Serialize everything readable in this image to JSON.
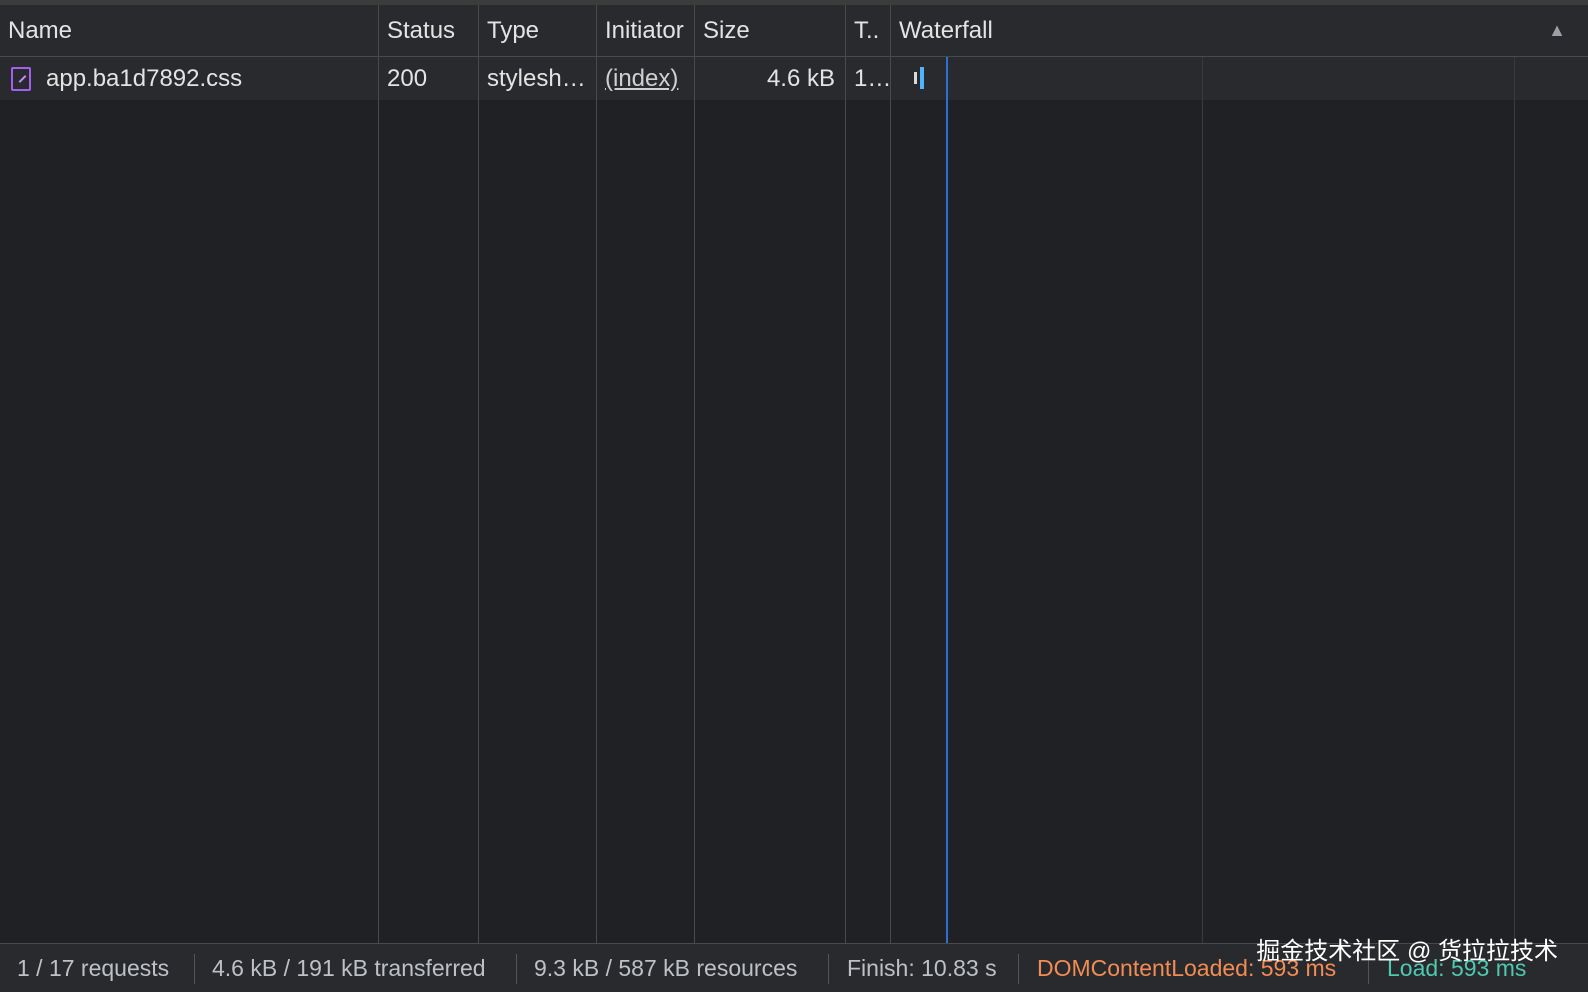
{
  "columns": {
    "name": "Name",
    "status": "Status",
    "type": "Type",
    "initiator": "Initiator",
    "size": "Size",
    "time": "T..",
    "waterfall": "Waterfall",
    "sort_indicator": "▲"
  },
  "rows": [
    {
      "icon": "stylesheet-file-icon",
      "name": "app.ba1d7892.css",
      "status": "200",
      "type": "stylesh…",
      "initiator": "(index)",
      "size": "4.6 kB",
      "time": "1…"
    }
  ],
  "footer": {
    "requests": "1 / 17 requests",
    "transferred": "4.6 kB / 191 kB transferred",
    "resources": "9.3 kB / 587 kB resources",
    "finish": "Finish: 10.83 s",
    "dom_content_loaded": "DOMContentLoaded: 593 ms",
    "load": "Load: 593 ms"
  },
  "watermark": "掘金技术社区 @ 货拉拉技术",
  "colors": {
    "background": "#202124",
    "dom_content_loaded": "#f28b54",
    "load": "#4ec9b0",
    "dcl_marker": "#2f6fd4",
    "icon_accent": "#a45ff0"
  }
}
